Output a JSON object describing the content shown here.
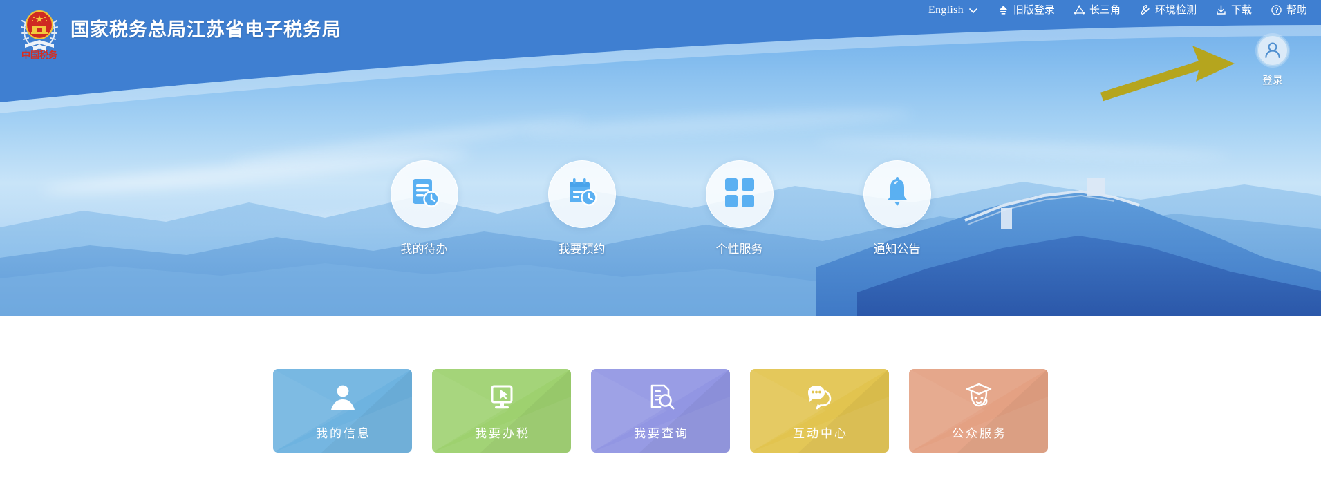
{
  "header": {
    "logo_alt": "国家税务总局徽标",
    "logo_text": "中国税务",
    "title": "国家税务总局江苏省电子税务局",
    "background_color": "#3f7fd1"
  },
  "nav": {
    "items": [
      {
        "label": "English",
        "icon": "chevron-down-icon",
        "type": "language"
      },
      {
        "label": "旧版登录",
        "icon": "upload-arrow-icon"
      },
      {
        "label": "长三角",
        "icon": "triangle-nodes-icon"
      },
      {
        "label": "环境检测",
        "icon": "wrench-icon"
      },
      {
        "label": "下载",
        "icon": "download-icon"
      },
      {
        "label": "帮助",
        "icon": "question-circle-icon"
      }
    ]
  },
  "login": {
    "label": "登录",
    "icon": "user-avatar-icon"
  },
  "annotation": {
    "type": "arrow",
    "color": "#b5a51e",
    "points_to": "登录"
  },
  "hero": {
    "scene": "长城山景",
    "shortcuts": [
      {
        "label": "我的待办",
        "icon": "document-clock-icon"
      },
      {
        "label": "我要预约",
        "icon": "calendar-clock-icon"
      },
      {
        "label": "个性服务",
        "icon": "grid-four-icon"
      },
      {
        "label": "通知公告",
        "icon": "bell-icon"
      }
    ]
  },
  "tiles": [
    {
      "label": "我的信息",
      "icon": "person-icon",
      "color": "#6eb3e0"
    },
    {
      "label": "我要办税",
      "icon": "monitor-cursor-icon",
      "color": "#9ed16f"
    },
    {
      "label": "我要查询",
      "icon": "document-search-icon",
      "color": "#9296e3"
    },
    {
      "label": "互动中心",
      "icon": "chat-bubbles-icon",
      "color": "#e2c44f"
    },
    {
      "label": "公众服务",
      "icon": "graduate-headset-icon",
      "color": "#e4a183"
    }
  ]
}
